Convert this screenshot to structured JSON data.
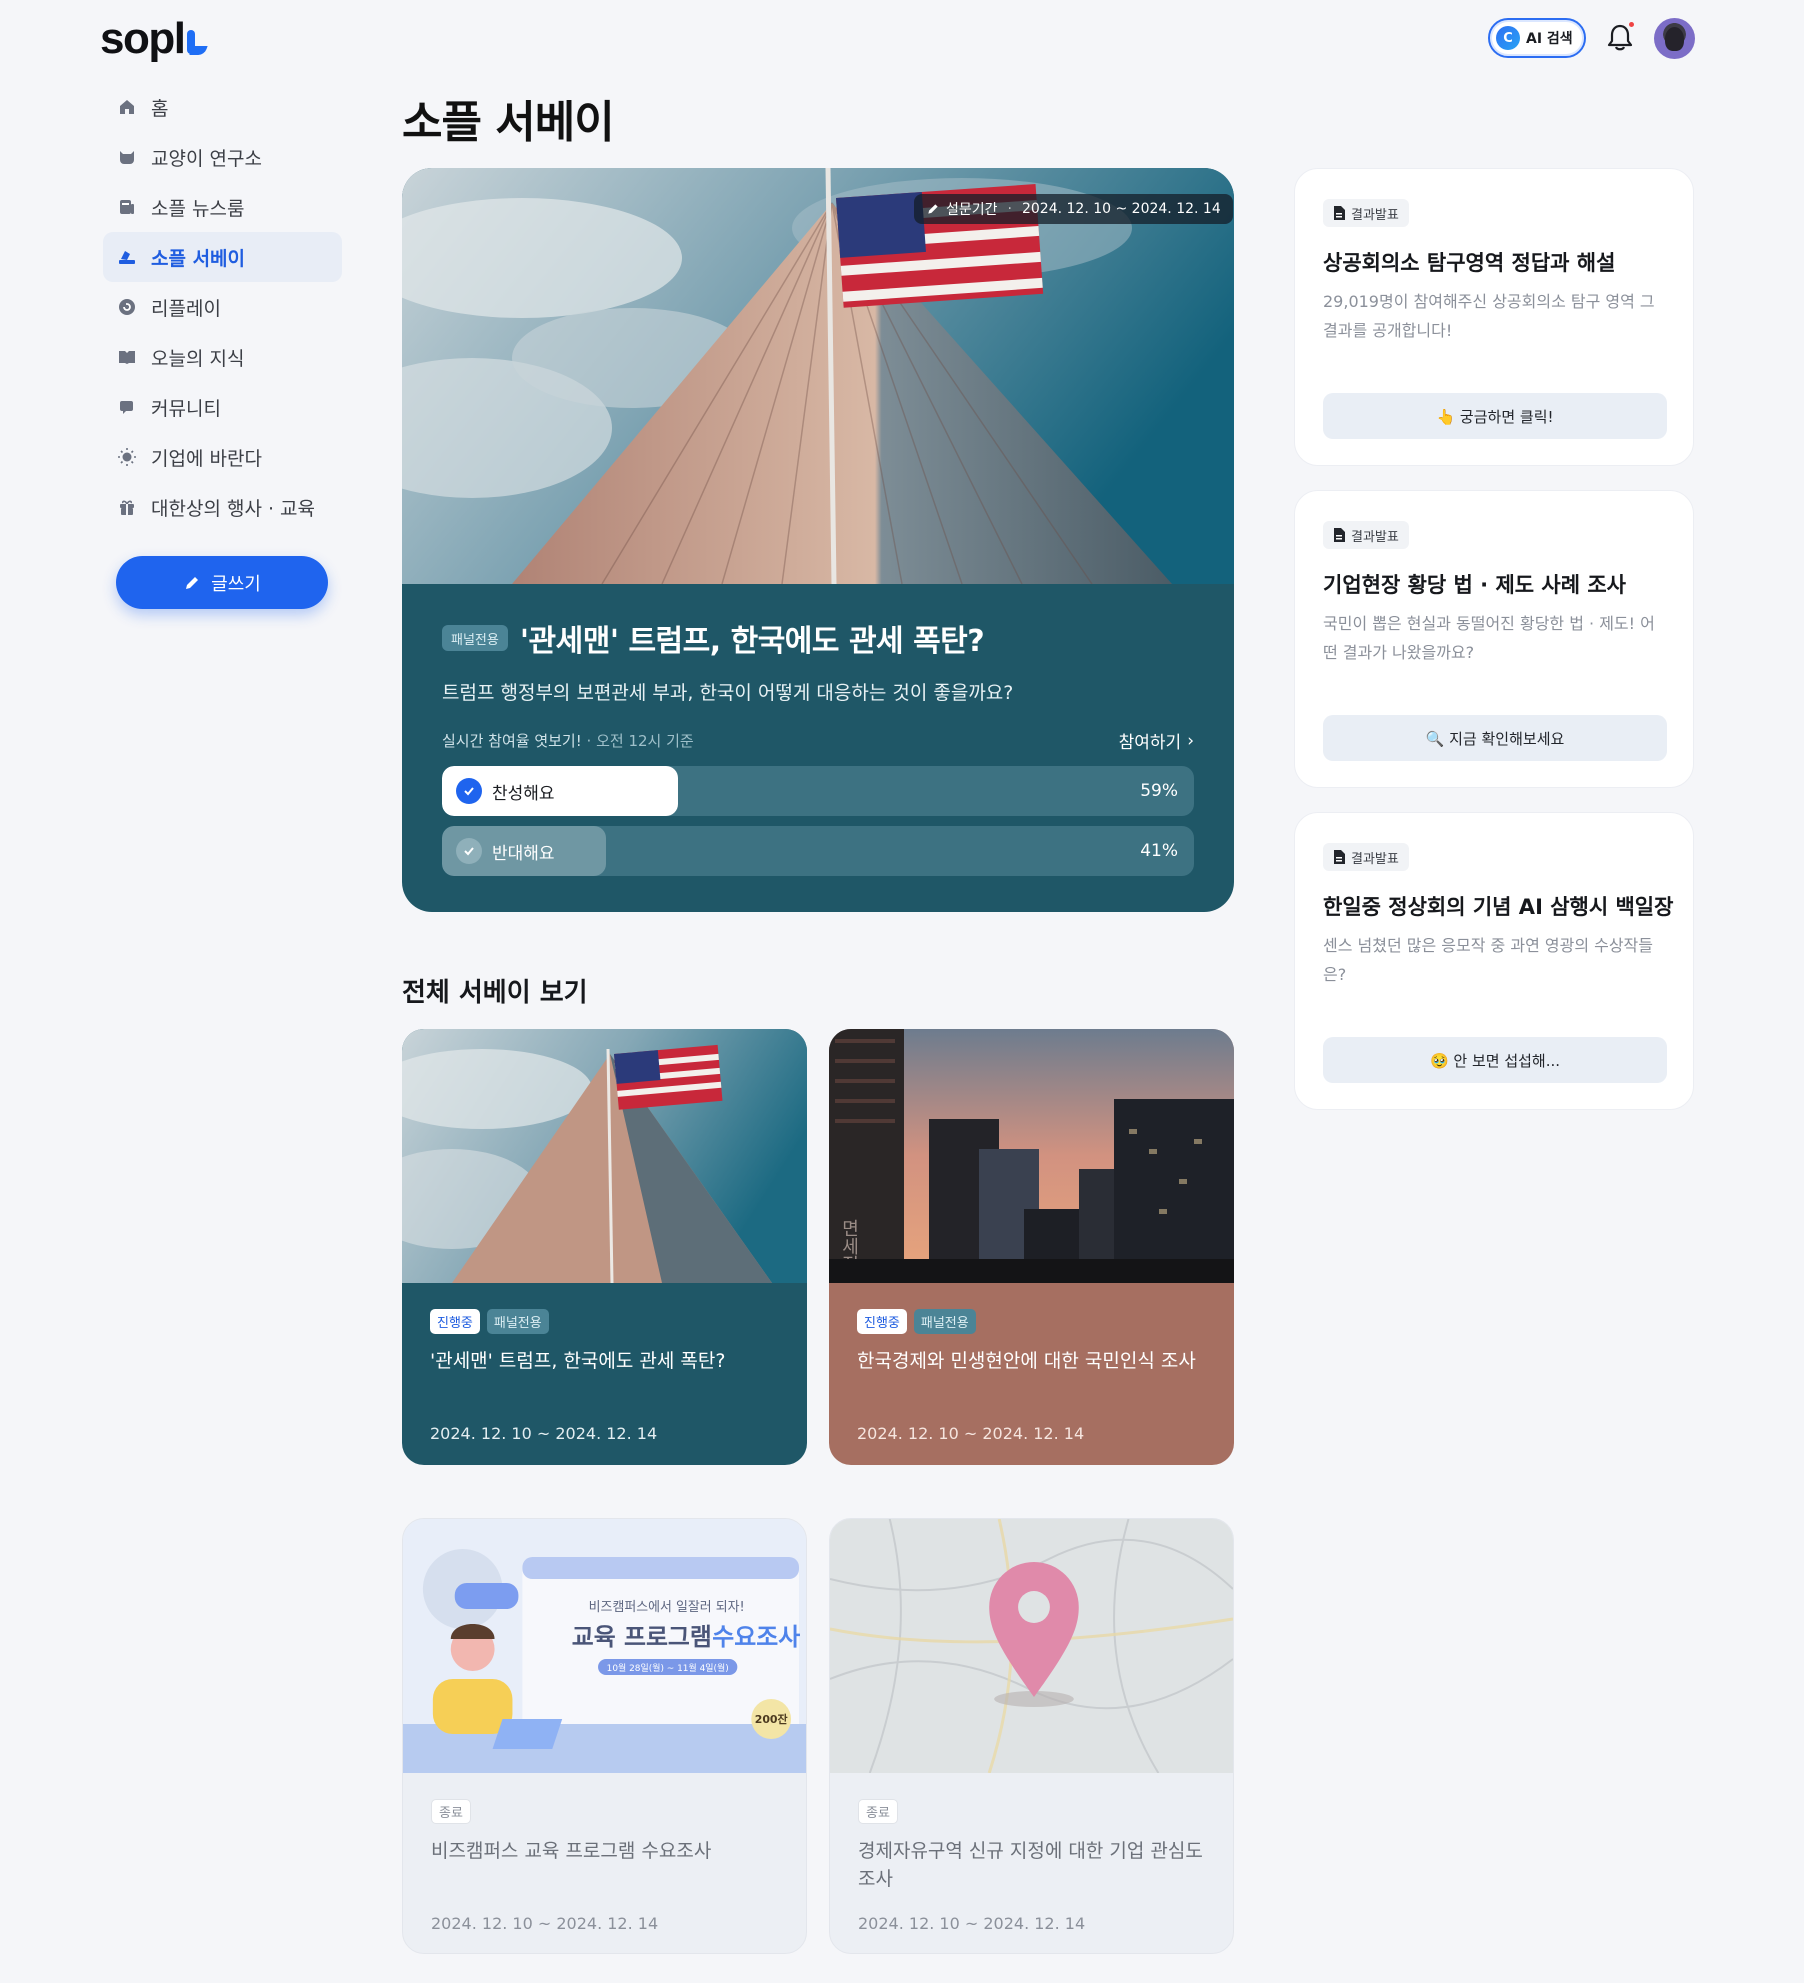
{
  "brand": {
    "logo_text": "sopl",
    "accent": "#1f64ee"
  },
  "header": {
    "ai_search_label": "AI 검색",
    "ai_icon_glyph": "C"
  },
  "sidebar": {
    "items": [
      {
        "label": "홈",
        "icon": "home-icon"
      },
      {
        "label": "교양이 연구소",
        "icon": "cat-icon"
      },
      {
        "label": "소플 뉴스룸",
        "icon": "newspaper-icon"
      },
      {
        "label": "소플 서베이",
        "icon": "survey-icon",
        "active": true
      },
      {
        "label": "리플레이",
        "icon": "replay-icon"
      },
      {
        "label": "오늘의 지식",
        "icon": "book-icon"
      },
      {
        "label": "커뮤니티",
        "icon": "chat-icon"
      },
      {
        "label": "기업에 바란다",
        "icon": "bulb-icon"
      },
      {
        "label": "대한상의 행사 · 교육",
        "icon": "gift-icon"
      }
    ],
    "write_label": "글쓰기"
  },
  "main": {
    "page_title": "소플 서베이",
    "hero": {
      "period_label": "설문기간",
      "period_dates": "2024. 12. 10 ~ 2024. 12. 14",
      "tag": "패널전용",
      "title": "'관세맨' 트럼프, 한국에도 관세 폭탄?",
      "subtitle": "트럼프 행정부의 보편관세 부과, 한국이 어떻게 대응하는 것이 좋을까요?",
      "live_label": "실시간 참여율 엿보기!",
      "live_time": "· 오전 12시 기준",
      "join_label": "참여하기",
      "options": [
        {
          "label": "찬성해요",
          "percent_text": "59%",
          "fraction": 0.59,
          "selected": true
        },
        {
          "label": "반대해요",
          "percent_text": "41%",
          "fraction": 0.41,
          "selected": false
        }
      ]
    },
    "section_title": "전체 서베이 보기",
    "cards": [
      {
        "status": "진행중",
        "tag": "패널전용",
        "title": "'관세맨' 트럼프, 한국에도 관세 폭탄?",
        "date": "2024. 12. 10 ~ 2024. 12. 14",
        "color": "#1f5767"
      },
      {
        "status": "진행중",
        "tag": "패널전용",
        "title": "한국경제와 민생현안에 대한 국민인식 조사",
        "date": "2024. 12. 10 ~ 2024. 12. 14",
        "color": "#a66f61",
        "image_text": "면세점"
      },
      {
        "status": "종료",
        "title": "비즈캠퍼스 교육 프로그램 수요조사",
        "date": "2024. 12. 10 ~ 2024. 12. 14",
        "image": {
          "top": "비즈캠퍼스에서 일잘러 되자!",
          "main_a": "교육 프로그램",
          "main_b": "수요조사",
          "dates": "10월 28일(월) ~ 11월 4일(월)",
          "badge": "200잔"
        }
      },
      {
        "status": "종료",
        "title": "경제자유구역 신규 지정에 대한 기업 관심도 조사",
        "date": "2024. 12. 10 ~ 2024. 12. 14"
      }
    ]
  },
  "results": [
    {
      "badge": "결과발표",
      "title": "상공회의소 탐구영역 정답과 해설",
      "desc": "29,019명이 참여해주신 상공회의소 탐구 영역 그 결과를 공개합니다!",
      "button": "👆 궁금하면 클릭!"
    },
    {
      "badge": "결과발표",
      "title": "기업현장 황당 법 · 제도 사례 조사",
      "desc": "국민이 뽑은 현실과 동떨어진 황당한 법 · 제도! 어떤 결과가 나왔을까요?",
      "button": "🔍 지금 확인해보세요"
    },
    {
      "badge": "결과발표",
      "title": "한일중 정상회의 기념 AI 삼행시 백일장",
      "desc": "센스 넘쳤던 많은 응모작 중 과연 영광의 수상작들은?",
      "button": "🥹 안 보면 섭섭해..."
    }
  ]
}
